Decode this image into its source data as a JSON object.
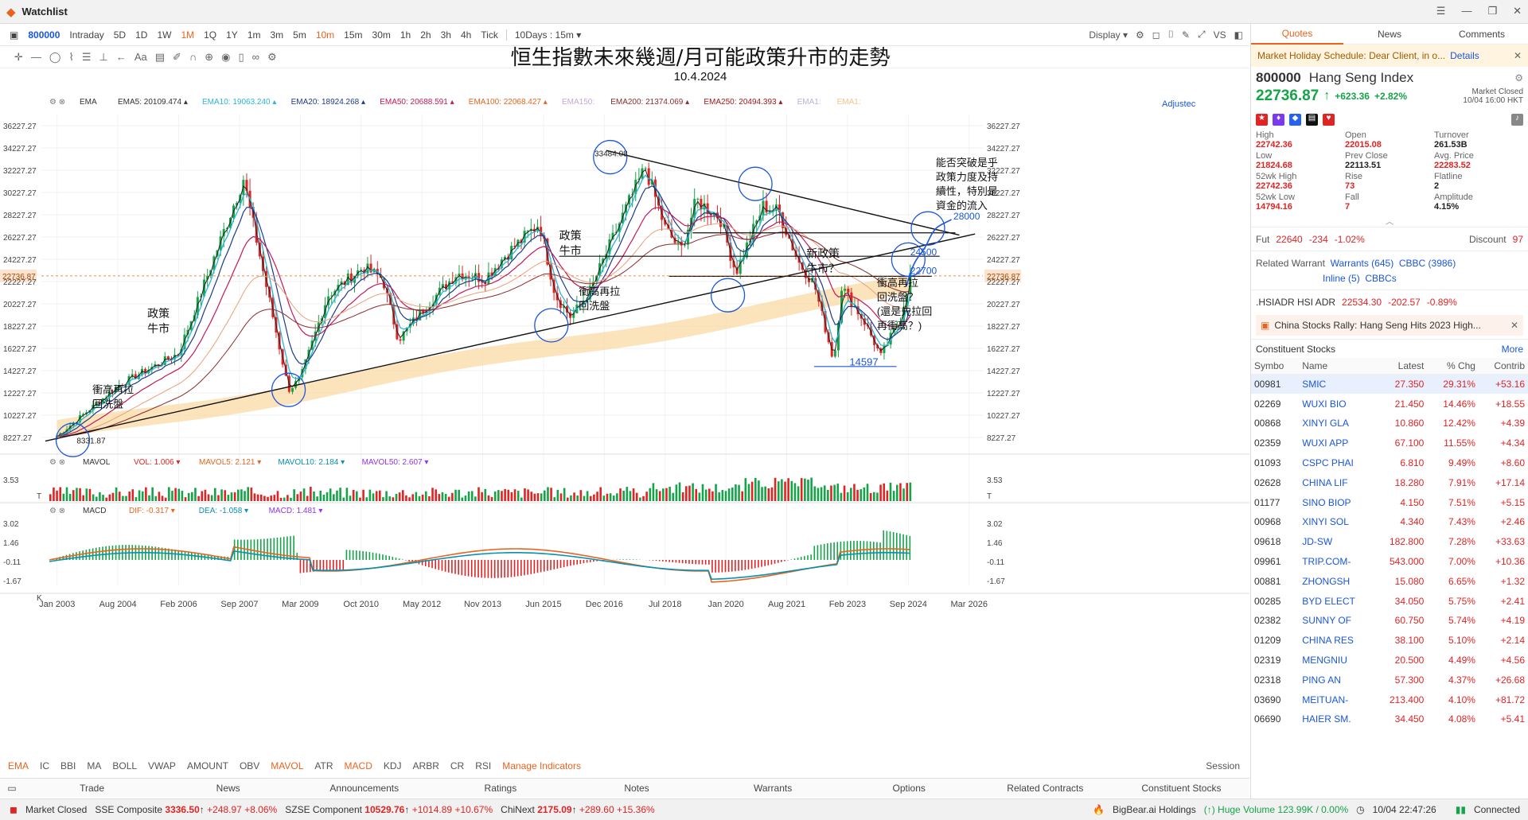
{
  "window": {
    "title": "Watchlist"
  },
  "toolbar": {
    "symbol": "800000",
    "periods": [
      "Intraday",
      "5D",
      "1D",
      "1W",
      "1M",
      "1Q",
      "1Y",
      "1m",
      "3m",
      "5m",
      "10m",
      "15m",
      "30m",
      "1h",
      "2h",
      "3h",
      "4h",
      "Tick"
    ],
    "active_periods": [
      "1M",
      "10m"
    ],
    "range_select": "10Days : 15m",
    "display": "Display",
    "vs": "VS"
  },
  "chart_overlay": {
    "title": "恒生指數未來幾週/月可能政策升市的走勢",
    "date": "10.4.2024",
    "adjusted_label": "Adjustec"
  },
  "ema_legend": {
    "name": "EMA",
    "items": [
      {
        "label": "EMA5: 20109.474",
        "color": "#333333"
      },
      {
        "label": "EMA10: 19063.240",
        "color": "#29b6d8"
      },
      {
        "label": "EMA20: 18924.268",
        "color": "#1e3a8a"
      },
      {
        "label": "EMA50: 20688.591",
        "color": "#c2185b"
      },
      {
        "label": "EMA100: 22068.427",
        "color": "#e8641e"
      },
      {
        "label": "EMA150:",
        "color": "#c6a9d6"
      },
      {
        "label": "EMA200: 21374.069",
        "color": "#8b2b2b"
      },
      {
        "label": "EMA250: 20494.393",
        "color": "#a01818"
      },
      {
        "label": "EMA1:",
        "color": "#b8b0e0"
      },
      {
        "label": "EMA1:",
        "color": "#f5c48a"
      }
    ]
  },
  "chart_data": [
    {
      "type": "line",
      "title": "",
      "ylabels": [
        "36227.27",
        "34227.27",
        "32227.27",
        "30227.27",
        "28227.27",
        "26227.27",
        "24227.27",
        "22227.27",
        "20227.27",
        "18227.27",
        "16227.27",
        "14227.27",
        "12227.27",
        "10227.27",
        "8227.27"
      ],
      "ylim": [
        7227.27,
        37227.27
      ],
      "xlabels": [
        "Jan 2003",
        "Aug 2004",
        "Feb 2006",
        "Sep 2007",
        "Mar 2009",
        "Oct 2010",
        "May 2012",
        "Nov 2013",
        "Jun 2015",
        "Dec 2016",
        "Jul 2018",
        "Jan 2020",
        "Aug 2021",
        "Feb 2023",
        "Sep 2024",
        "Mar 2026"
      ],
      "series": [
        {
          "name": "Hang Seng Index",
          "x": [
            2003.0,
            2004.6,
            2006.1,
            2007.75,
            2008.2,
            2008.9,
            2009.2,
            2009.9,
            2010.8,
            2011.3,
            2011.7,
            2012.4,
            2013.2,
            2013.9,
            2014.4,
            2015.3,
            2015.7,
            2016.1,
            2016.6,
            2017.4,
            2018.0,
            2018.5,
            2018.9,
            2019.3,
            2019.9,
            2020.3,
            2021.0,
            2021.4,
            2021.9,
            2022.3,
            2022.8,
            2023.0,
            2023.6,
            2024.0,
            2024.5,
            2024.75
          ],
          "y": [
            8331.87,
            13000,
            15800,
            31500,
            24000,
            12500,
            13500,
            21000,
            23500,
            22500,
            17000,
            20000,
            23000,
            22500,
            24500,
            27500,
            21000,
            19000,
            21500,
            28000,
            32500,
            27000,
            25000,
            29500,
            28000,
            23000,
            29000,
            28500,
            24000,
            22000,
            15000,
            21800,
            18500,
            15500,
            19000,
            22736.87
          ]
        }
      ],
      "last_price": "22736.87",
      "annotations": [
        "33484.08",
        "8331.87",
        "政策\n牛市",
        "衝高再拉\n回洗盤",
        "政策\n牛市",
        "衝高再拉\n回洗盤",
        "新政策\n牛市？",
        "衝高再拉\n回洗盤？\n(還是先拉回\n再衝高？)",
        "能否突破是乎\n政策力度及持\n續性，特別是\n資金的流入",
        "28000",
        "24500",
        "22700",
        "14597"
      ]
    },
    {
      "type": "bar",
      "title": "MAVOL",
      "legend": [
        "VOL: 1.006",
        "MAVOL5: 2.121",
        "MAVOL10: 2.184",
        "MAVOL50: 2.607"
      ],
      "ylabels": [
        "3.53",
        "T"
      ]
    },
    {
      "type": "bar",
      "title": "MACD",
      "legend": [
        "DIF: -0.317",
        "DEA: -1.058",
        "MACD: 1.481"
      ],
      "ylabels": [
        "3.02",
        "1.46",
        "-0.11",
        "-1.67",
        "K"
      ]
    }
  ],
  "indicators": [
    "EMA",
    "IC",
    "BBI",
    "MA",
    "BOLL",
    "VWAP",
    "AMOUNT",
    "OBV",
    "MAVOL",
    "ATR",
    "MACD",
    "KDJ",
    "ARBR",
    "CR",
    "RSI"
  ],
  "manage_indicators": "Manage Indicators",
  "session": "Session",
  "bottom_tabs": [
    "Trade",
    "News",
    "Announcements",
    "Ratings",
    "Notes",
    "Warrants",
    "Options",
    "Related Contracts",
    "Constituent Stocks"
  ],
  "status": {
    "market": "Market Closed",
    "sse": {
      "label": "SSE Composite",
      "value": "3336.50",
      "chg": "+248.97",
      "pct": "+8.06%"
    },
    "szse": {
      "label": "SZSE Component",
      "value": "10529.76",
      "chg": "+1014.89",
      "pct": "+10.67%"
    },
    "chinext": {
      "label": "ChiNext",
      "value": "2175.09",
      "chg": "+289.60",
      "pct": "+15.36%"
    },
    "ticker": "BigBear.ai Holdings",
    "ticker_msg": "(↑) Huge Volume 123.99K / 0.00%",
    "time": "10/04 22:47:26",
    "connected": "Connected"
  },
  "right_panel": {
    "tabs": [
      "Quotes",
      "News",
      "Comments"
    ],
    "holiday": "Market Holiday Schedule: Dear Client, in o...",
    "holiday_link": "Details",
    "quote": {
      "code": "800000",
      "name": "Hang Seng Index",
      "price": "22736.87",
      "chg": "+623.36",
      "pct": "+2.82%",
      "status": "Market Closed",
      "time": "10/04 16:00 HKT"
    },
    "stats": [
      {
        "label": "High",
        "value": "22742.36",
        "color": "#e02424"
      },
      {
        "label": "Open",
        "value": "22015.08",
        "color": "#e02424"
      },
      {
        "label": "Turnover",
        "value": "261.53B",
        "color": "#222222"
      },
      {
        "label": "Low",
        "value": "21824.68",
        "color": "#e02424"
      },
      {
        "label": "Prev Close",
        "value": "22113.51",
        "color": "#222222"
      },
      {
        "label": "Avg. Price",
        "value": "22283.52",
        "color": "#e02424"
      },
      {
        "label": "52wk High",
        "value": "22742.36",
        "color": "#e02424"
      },
      {
        "label": "Rise",
        "value": "73",
        "color": "#e02424"
      },
      {
        "label": "Flatline",
        "value": "2",
        "color": "#222222"
      },
      {
        "label": "52wk Low",
        "value": "14794.16",
        "color": "#e02424"
      },
      {
        "label": "Fall",
        "value": "7",
        "color": "#e02424"
      },
      {
        "label": "Amplitude",
        "value": "4.15%",
        "color": "#222222"
      }
    ],
    "fut": {
      "label": "Fut",
      "price": "22640",
      "chg": "-234",
      "pct": "-1.02%",
      "disc_label": "Discount",
      "disc": "97"
    },
    "related": {
      "label": "Related Warrant",
      "warrants": "Warrants (645)",
      "cbbc": "CBBC (3986)",
      "inline": "Inline (5)",
      "cbbcs": "CBBCs"
    },
    "adr": {
      "label": ".HSIADR HSI ADR",
      "price": "22534.30",
      "chg": "-202.57",
      "pct": "-0.89%"
    },
    "news": "China Stocks Rally: Hang Seng Hits 2023 High...",
    "constituents": {
      "title": "Constituent Stocks",
      "more": "More",
      "headers": [
        "Symbo",
        "Name",
        "Latest",
        "% Chg",
        "Contrib"
      ],
      "rows": [
        [
          "00981",
          "SMIC",
          "27.350",
          "29.31%",
          "+53.16"
        ],
        [
          "02269",
          "WUXI BIO",
          "21.450",
          "14.46%",
          "+18.55"
        ],
        [
          "00868",
          "XINYI GLA",
          "10.860",
          "12.42%",
          "+4.39"
        ],
        [
          "02359",
          "WUXI APP",
          "67.100",
          "11.55%",
          "+4.34"
        ],
        [
          "01093",
          "CSPC PHAI",
          "6.810",
          "9.49%",
          "+8.60"
        ],
        [
          "02628",
          "CHINA LIF",
          "18.280",
          "7.91%",
          "+17.14"
        ],
        [
          "01177",
          "SINO BIOP",
          "4.150",
          "7.51%",
          "+5.15"
        ],
        [
          "00968",
          "XINYI SOL",
          "4.340",
          "7.43%",
          "+2.46"
        ],
        [
          "09618",
          "JD-SW",
          "182.800",
          "7.28%",
          "+33.63"
        ],
        [
          "09961",
          "TRIP.COM-",
          "543.000",
          "7.00%",
          "+10.36"
        ],
        [
          "00881",
          "ZHONGSH",
          "15.080",
          "6.65%",
          "+1.32"
        ],
        [
          "00285",
          "BYD ELECT",
          "34.050",
          "5.75%",
          "+2.41"
        ],
        [
          "02382",
          "SUNNY OF",
          "60.750",
          "5.74%",
          "+4.19"
        ],
        [
          "01209",
          "CHINA RES",
          "38.100",
          "5.10%",
          "+2.14"
        ],
        [
          "02319",
          "MENGNIU",
          "20.500",
          "4.49%",
          "+4.56"
        ],
        [
          "02318",
          "PING AN",
          "57.300",
          "4.37%",
          "+26.68"
        ],
        [
          "03690",
          "MEITUAN-",
          "213.400",
          "4.10%",
          "+81.72"
        ],
        [
          "06690",
          "HAIER SM.",
          "34.450",
          "4.08%",
          "+5.41"
        ]
      ]
    }
  }
}
